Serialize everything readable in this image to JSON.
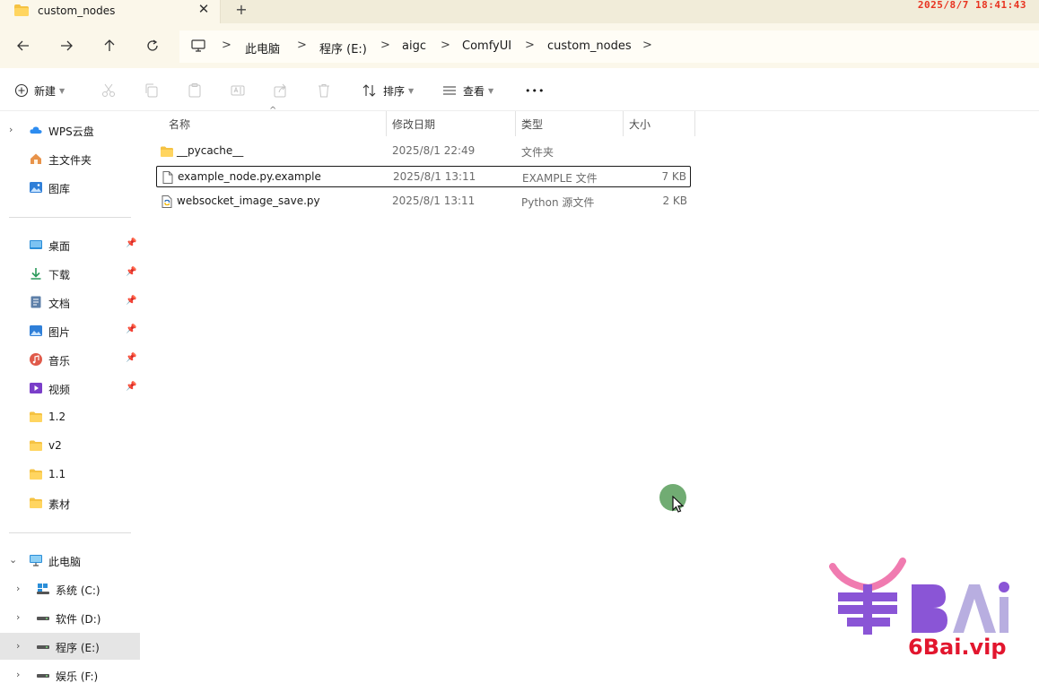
{
  "window": {
    "tab_title": "custom_nodes",
    "close_glyph": "✕",
    "new_tab_glyph": "+",
    "clock": "2025/8/7  18:41:43"
  },
  "nav": {
    "back_icon": "arrow-left-icon",
    "forward_icon": "arrow-right-icon",
    "up_icon": "arrow-up-icon",
    "refresh_icon": "refresh-icon",
    "breadcrumbs": [
      "此电脑",
      "程序 (E:)",
      "aigc",
      "ComfyUI",
      "custom_nodes"
    ],
    "separator": ">"
  },
  "toolbar": {
    "new_label": "新建",
    "sort_label": "排序",
    "view_label": "查看",
    "more_glyph": "•••"
  },
  "sidebar": {
    "top": [
      {
        "label": "WPS云盘",
        "icon": "cloud-icon"
      },
      {
        "label": "主文件夹",
        "icon": "home-icon"
      },
      {
        "label": "图库",
        "icon": "gallery-icon"
      }
    ],
    "quick": [
      {
        "label": "桌面",
        "icon": "desktop-icon"
      },
      {
        "label": "下载",
        "icon": "download-icon"
      },
      {
        "label": "文档",
        "icon": "document-icon"
      },
      {
        "label": "图片",
        "icon": "picture-icon"
      },
      {
        "label": "音乐",
        "icon": "music-icon"
      },
      {
        "label": "视频",
        "icon": "video-icon"
      },
      {
        "label": "1.2",
        "icon": "folder-icon"
      },
      {
        "label": "v2",
        "icon": "folder-icon"
      },
      {
        "label": "1.1",
        "icon": "folder-icon"
      },
      {
        "label": "素材",
        "icon": "folder-icon"
      }
    ],
    "this_pc": "此电脑",
    "drives": [
      "系统 (C:)",
      "软件 (D:)",
      "程序 (E:)",
      "娱乐 (F:)"
    ],
    "pin_glyph": "📌"
  },
  "columns": [
    "名称",
    "修改日期",
    "类型",
    "大小"
  ],
  "files": [
    {
      "name": "__pycache__",
      "date": "2025/8/1 22:49",
      "type": "文件夹",
      "size": "",
      "icon": "folder-icon"
    },
    {
      "name": "example_node.py.example",
      "date": "2025/8/1 13:11",
      "type": "EXAMPLE 文件",
      "size": "7 KB",
      "icon": "file-icon"
    },
    {
      "name": "websocket_image_save.py",
      "date": "2025/8/1 13:11",
      "type": "Python 源文件",
      "size": "2 KB",
      "icon": "python-file-icon"
    }
  ],
  "watermark": {
    "text": "6Bai.vip"
  },
  "colors": {
    "accent_folder": "#f5c242",
    "watermark_red": "#e2162e",
    "watermark_purple": "#8a55d6",
    "clock_red": "#e8321f"
  }
}
